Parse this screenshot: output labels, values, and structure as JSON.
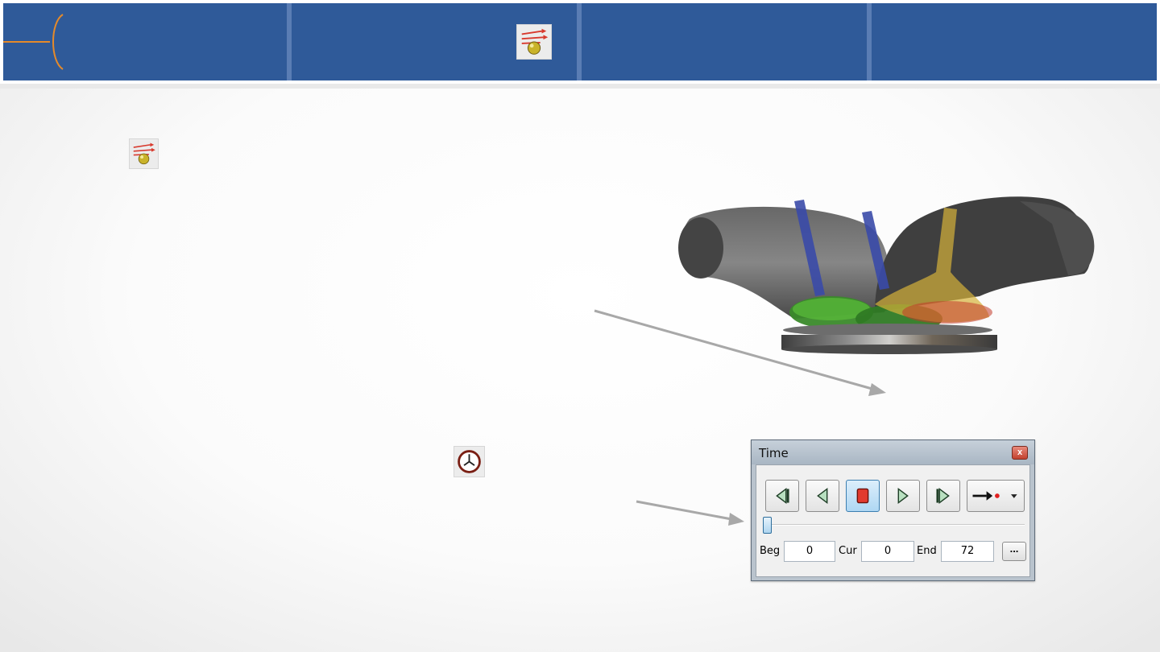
{
  "header": {
    "segments": 4
  },
  "icons": {
    "header_tool": "particle-flow-icon",
    "body_tool": "particle-flow-icon",
    "time_tool": "clock-icon"
  },
  "render": {
    "subject": "engine-intake-valves-3d-render"
  },
  "time_window": {
    "title": "Time",
    "close_symbol": "x",
    "buttons": [
      {
        "name": "first-frame-button",
        "icon": "skip-to-start-icon"
      },
      {
        "name": "previous-frame-button",
        "icon": "step-back-icon"
      },
      {
        "name": "stop-button",
        "icon": "stop-icon"
      },
      {
        "name": "play-button",
        "icon": "play-icon"
      },
      {
        "name": "last-frame-button",
        "icon": "skip-to-end-icon"
      },
      {
        "name": "record-mode-button",
        "icon": "arrow-record-icon"
      }
    ],
    "labels": {
      "beg": "Beg",
      "cur": "Cur",
      "end": "End"
    },
    "values": {
      "beg": "0",
      "cur": "0",
      "end": "72"
    },
    "more_label": "...",
    "slider_position": 0
  },
  "colors": {
    "header_blue": "#2f5a99",
    "accent_orange": "#e58a2a",
    "arrow_gray": "#a8a8a8"
  }
}
